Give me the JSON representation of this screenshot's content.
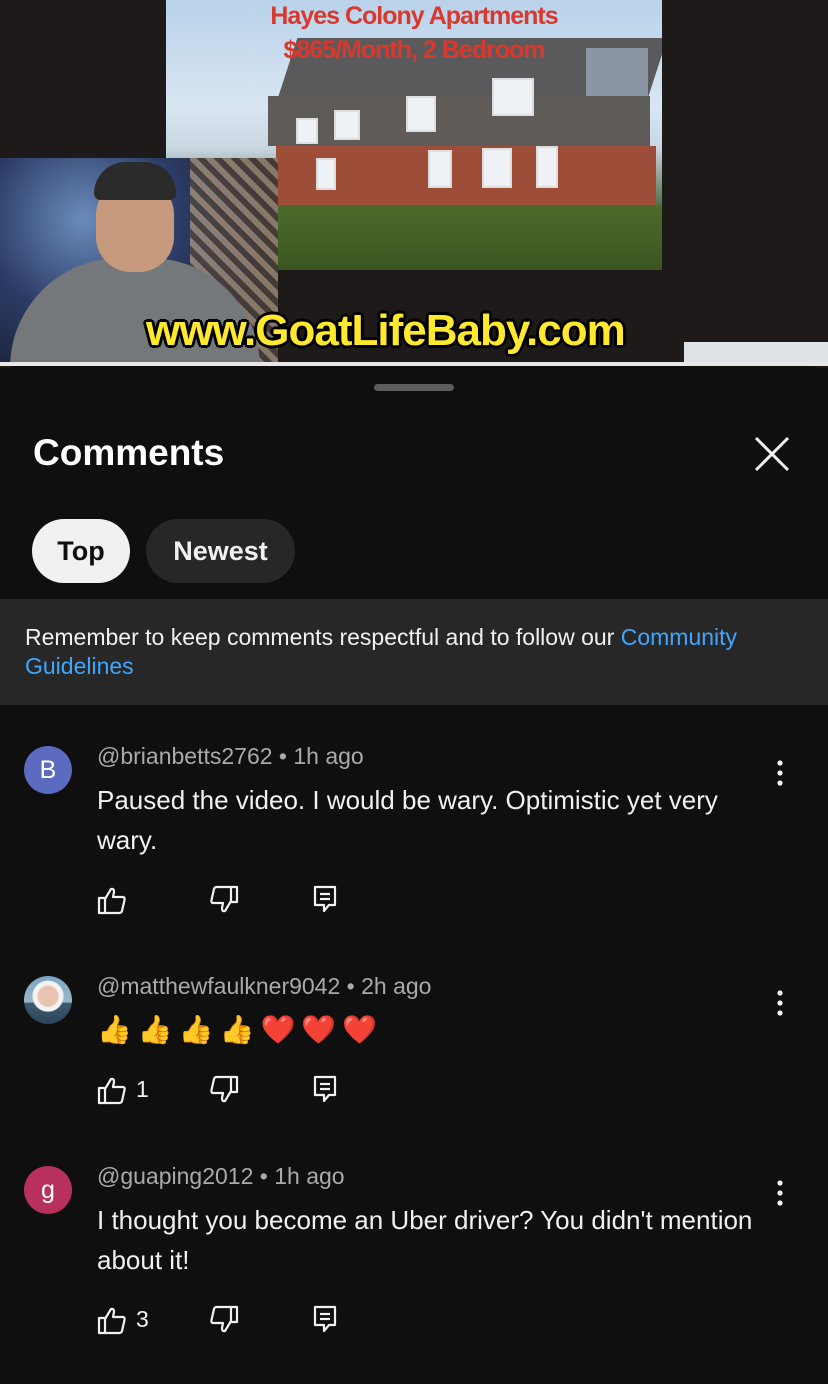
{
  "video": {
    "slide_title_line1": "Hayes Colony Apartments",
    "slide_title_line2": "$865/Month, 2 Bedroom",
    "watermark_url": "www.GoatLifeBaby.com"
  },
  "comments_panel": {
    "title": "Comments",
    "close_icon": "close-icon",
    "filters": [
      {
        "label": "Top",
        "selected": true
      },
      {
        "label": "Newest",
        "selected": false
      }
    ],
    "notice": {
      "text": "Remember to keep comments respectful and to follow our ",
      "link": "Community Guidelines"
    },
    "comments": [
      {
        "avatar_letter": "B",
        "avatar_color": "#5c6bc0",
        "author": "@brianbetts2762",
        "time": "1h ago",
        "text": "Paused the video. I would be wary. Optimistic yet very wary.",
        "likes": ""
      },
      {
        "avatar_letter": "",
        "avatar_color": "#7aa6c8",
        "author": "@matthewfaulkner9042",
        "time": "2h ago",
        "text": "👍👍👍👍❤️❤️❤️",
        "likes": "1"
      },
      {
        "avatar_letter": "g",
        "avatar_color": "#b8315d",
        "author": "@guaping2012",
        "time": "1h ago",
        "text": "I thought you become an Uber driver? You didn't mention about it!",
        "likes": "3"
      }
    ]
  }
}
